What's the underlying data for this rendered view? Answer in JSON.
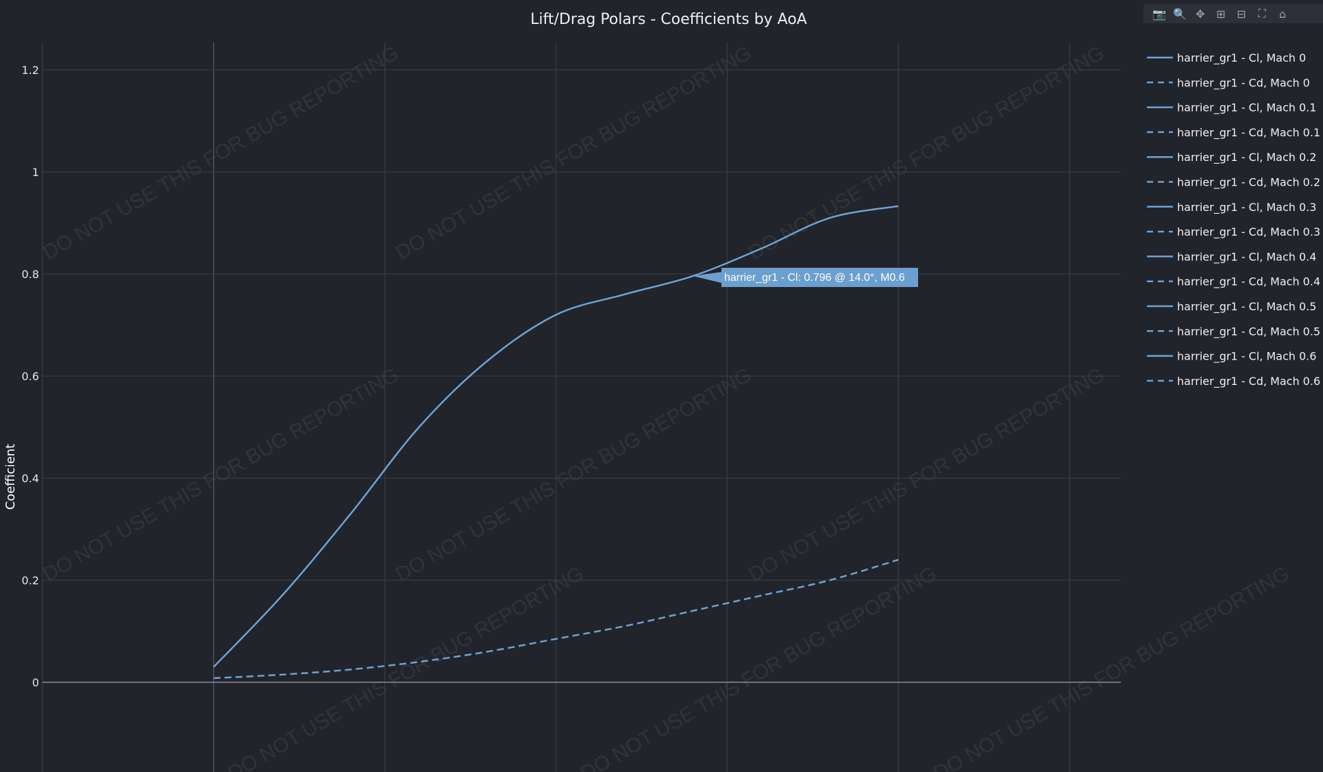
{
  "chart_data": {
    "type": "line",
    "title": "Lift/Drag Polars - Coefficients by AoA",
    "ylabel": "Coefficient",
    "xlabel": "",
    "xlim": [
      -5,
      26.5
    ],
    "ylim": [
      -0.175,
      1.29
    ],
    "yticks": [
      0,
      0.2,
      0.4,
      0.6,
      0.8,
      1,
      1.2
    ],
    "ytick_labels": [
      "0",
      "0.2",
      "0.4",
      "0.6",
      "0.8",
      "1",
      "1.2"
    ],
    "xgrid": [
      -5,
      0,
      5,
      10,
      15,
      20,
      25
    ],
    "grid": true,
    "legend_position": "right",
    "colors": {
      "cl": "#6ea3d6",
      "cd": "#6ea3d6",
      "background": "#22242b",
      "grid": "#3d4049",
      "hover_bg": "#6b9fcf"
    },
    "series": [
      {
        "name": "harrier_gr1 - Cl, Mach 0.6",
        "dash": "solid",
        "x": [
          0,
          2,
          4,
          6,
          8,
          10,
          12,
          14,
          16,
          18,
          20
        ],
        "y": [
          0.03,
          0.17,
          0.33,
          0.5,
          0.63,
          0.72,
          0.76,
          0.796,
          0.85,
          0.91,
          0.933
        ]
      },
      {
        "name": "harrier_gr1 - Cd, Mach 0.6",
        "dash": "dash",
        "x": [
          0,
          2,
          4,
          6,
          8,
          10,
          12,
          14,
          16,
          18,
          20
        ],
        "y": [
          0.008,
          0.015,
          0.025,
          0.04,
          0.06,
          0.085,
          0.11,
          0.14,
          0.17,
          0.2,
          0.24
        ]
      }
    ],
    "legend": [
      {
        "label": "harrier_gr1 - Cl, Mach 0",
        "dash": "solid"
      },
      {
        "label": "harrier_gr1 - Cd, Mach 0",
        "dash": "dash"
      },
      {
        "label": "harrier_gr1 - Cl, Mach 0.1",
        "dash": "solid"
      },
      {
        "label": "harrier_gr1 - Cd, Mach 0.1",
        "dash": "dash"
      },
      {
        "label": "harrier_gr1 - Cl, Mach 0.2",
        "dash": "solid"
      },
      {
        "label": "harrier_gr1 - Cd, Mach 0.2",
        "dash": "dash"
      },
      {
        "label": "harrier_gr1 - Cl, Mach 0.3",
        "dash": "solid"
      },
      {
        "label": "harrier_gr1 - Cd, Mach 0.3",
        "dash": "dash"
      },
      {
        "label": "harrier_gr1 - Cl, Mach 0.4",
        "dash": "solid"
      },
      {
        "label": "harrier_gr1 - Cd, Mach 0.4",
        "dash": "dash"
      },
      {
        "label": "harrier_gr1 - Cl, Mach 0.5",
        "dash": "solid"
      },
      {
        "label": "harrier_gr1 - Cd, Mach 0.5",
        "dash": "dash"
      },
      {
        "label": "harrier_gr1 - Cl, Mach 0.6",
        "dash": "solid"
      },
      {
        "label": "harrier_gr1 - Cd, Mach 0.6",
        "dash": "dash"
      }
    ],
    "hover": {
      "text": "harrier_gr1 - Cl: 0.796 @ 14.0°, M0.6",
      "x": 14,
      "y": 0.796
    },
    "watermark": "DO NOT USE THIS FOR BUG REPORTING"
  },
  "modebar": {
    "buttons": [
      {
        "name": "camera-icon",
        "glyph": "📷"
      },
      {
        "name": "zoom-icon",
        "glyph": "🔍"
      },
      {
        "name": "pan-icon",
        "glyph": "✥"
      },
      {
        "name": "zoom-in-icon",
        "glyph": "⊞"
      },
      {
        "name": "zoom-out-icon",
        "glyph": "⊟"
      },
      {
        "name": "autoscale-icon",
        "glyph": "⛶"
      },
      {
        "name": "reset-axes-icon",
        "glyph": "⌂"
      }
    ]
  }
}
